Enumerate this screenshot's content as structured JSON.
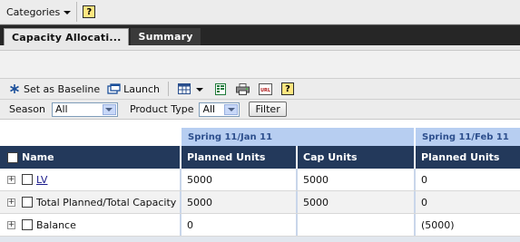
{
  "header": {
    "categories_label": "Categories",
    "help_label": "?"
  },
  "tabs": [
    {
      "label": "Capacity Allocati..."
    },
    {
      "label": "Summary"
    }
  ],
  "toolbar": {
    "set_baseline_label": "Set as Baseline",
    "launch_label": "Launch",
    "url_label": "URL",
    "help_label": "?"
  },
  "filters": {
    "season_label": "Season",
    "season_value": "All",
    "product_type_label": "Product Type",
    "product_type_value": "All",
    "filter_button": "Filter"
  },
  "grid": {
    "periods": [
      "Spring 11/Jan 11",
      "Spring 11/Feb 11"
    ],
    "columns": [
      "Name",
      "Planned Units",
      "Cap Units",
      "Planned Units"
    ],
    "rows": [
      {
        "name": "LV",
        "is_link": true,
        "values": [
          "5000",
          "5000",
          "0"
        ]
      },
      {
        "name": "Total Planned/Total Capacity",
        "is_link": false,
        "values": [
          "5000",
          "5000",
          "0"
        ]
      },
      {
        "name": "Balance",
        "is_link": false,
        "values": [
          "0",
          "",
          "(5000)"
        ]
      }
    ]
  },
  "colors": {
    "header_bg": "#23395b",
    "period_bg": "#b7cef1",
    "tab_strip": "#262626"
  }
}
